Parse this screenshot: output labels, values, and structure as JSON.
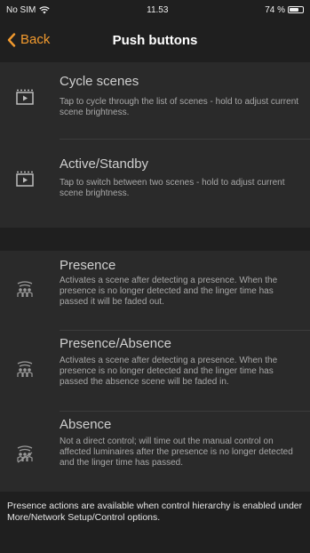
{
  "status": {
    "carrier": "No SIM",
    "time": "11.53",
    "battery": "74 %",
    "battery_level": 0.74
  },
  "nav": {
    "back_label": "Back",
    "title": "Push buttons"
  },
  "scenes": [
    {
      "title": "Cycle scenes",
      "description": "Tap to cycle through the list of scenes - hold to adjust current scene brightness.",
      "icon": "scene-icon"
    },
    {
      "title": "Active/Standby",
      "description": "Tap to switch between two scenes - hold to adjust current scene brightness.",
      "icon": "scene-icon"
    }
  ],
  "presence": [
    {
      "title": "Presence",
      "description": "Activates a scene after detecting a presence. When the presence is no longer detected and the linger time has passed it will be faded out.",
      "icon": "presence-icon"
    },
    {
      "title": "Presence/Absence",
      "description": "Activates a scene after detecting a presence. When the presence is no longer detected and the linger time has passed the absence scene will be faded in.",
      "icon": "presence-absence-icon"
    },
    {
      "title": "Absence",
      "description": "Not a direct control; will time out the manual control on affected luminaires after the presence is no longer detected and the linger time has passed.",
      "icon": "absence-icon"
    }
  ],
  "footer": {
    "note": "Presence actions are available when control hierarchy is enabled under More/Network Setup/Control options."
  }
}
